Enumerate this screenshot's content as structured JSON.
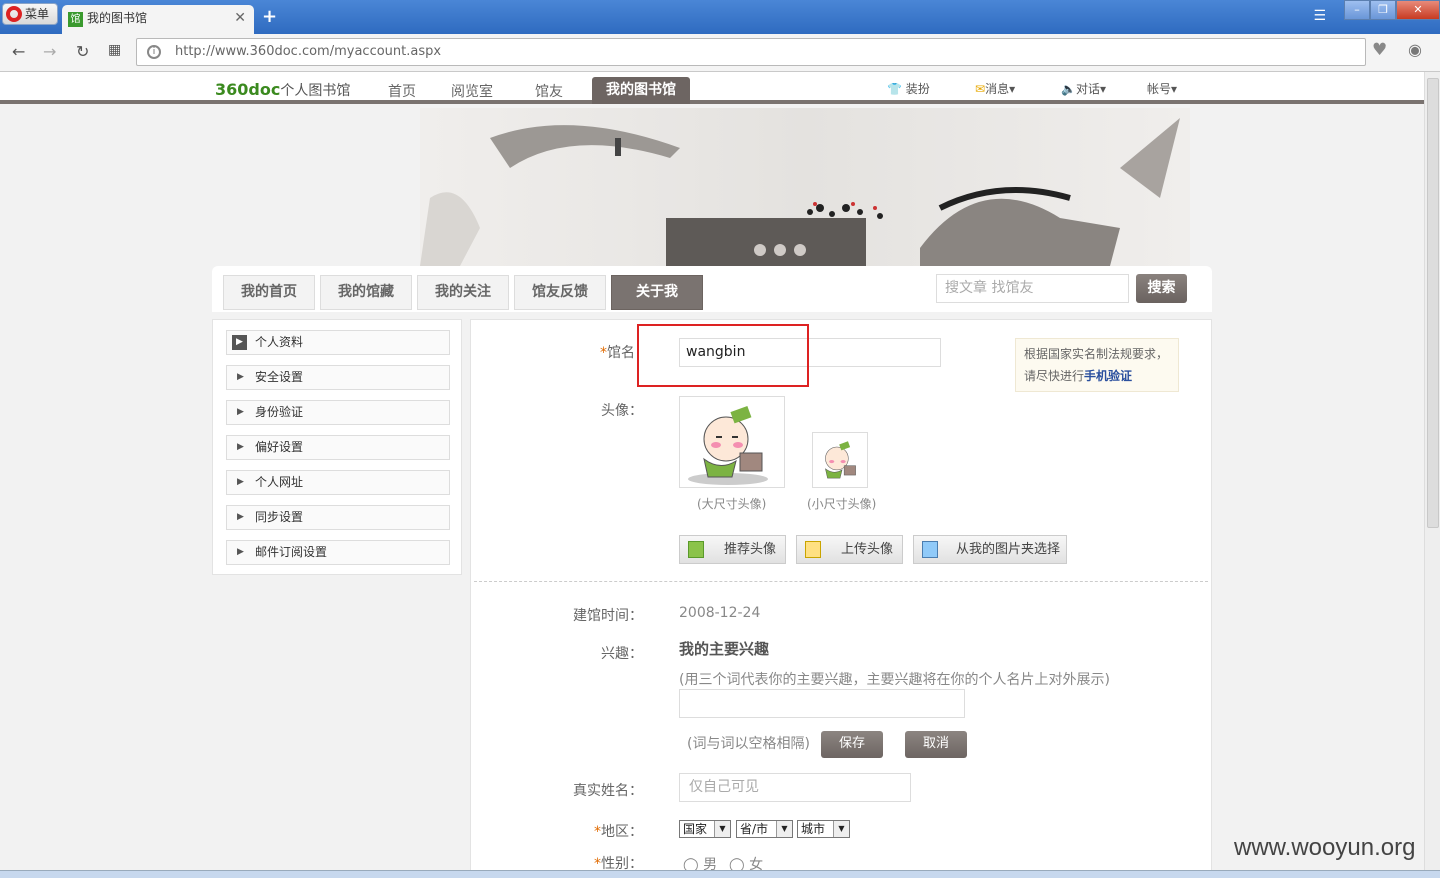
{
  "browser": {
    "menu_label": "菜单",
    "tab_title": "我的图书馆",
    "tab_favicon": "馆",
    "url": "http://www.360doc.com/myaccount.aspx"
  },
  "site": {
    "logo_brand": "360doc",
    "logo_sub": "个人图书馆",
    "nav": [
      "首页",
      "阅览室",
      "馆友",
      "我的图书馆"
    ],
    "right_links": [
      "装扮",
      "消息▾",
      "对话▾",
      "帐号▾"
    ]
  },
  "page_tabs": [
    "我的首页",
    "我的馆藏",
    "我的关注",
    "馆友反馈",
    "关于我"
  ],
  "search": {
    "placeholder": "搜文章 找馆友",
    "button": "搜索"
  },
  "sidebar": [
    "个人资料",
    "安全设置",
    "身份验证",
    "偏好设置",
    "个人网址",
    "同步设置",
    "邮件订阅设置"
  ],
  "form": {
    "name_label": "馆名",
    "name_value": "wangbin",
    "notice_line1": "根据国家实名制法规要求，",
    "notice_line2": "请尽快进行",
    "notice_link": "手机验证",
    "avatar_label": "头像：",
    "big_caption": "(大尺寸头像)",
    "small_caption": "(小尺寸头像)",
    "btn_recommend": "推荐头像",
    "btn_upload": "上传头像",
    "btn_album": "从我的图片夹选择",
    "created_label": "建馆时间：",
    "created_value": "2008-12-24",
    "interest_label": "兴趣：",
    "interest_title": "我的主要兴趣",
    "interest_hint": "(用三个词代表你的主要兴趣，主要兴趣将在你的个人名片上对外展示)",
    "interest_note": "(词与词以空格相隔)",
    "save": "保存",
    "cancel": "取消",
    "realname_label": "真实姓名：",
    "realname_placeholder": "仅自己可见",
    "region_label": "地区：",
    "region_country": "国家",
    "region_province": "省/市",
    "region_city": "城市",
    "gender_label": "性别：",
    "gender_male": "男",
    "gender_female": "女"
  },
  "watermark": "www.wooyun.org"
}
